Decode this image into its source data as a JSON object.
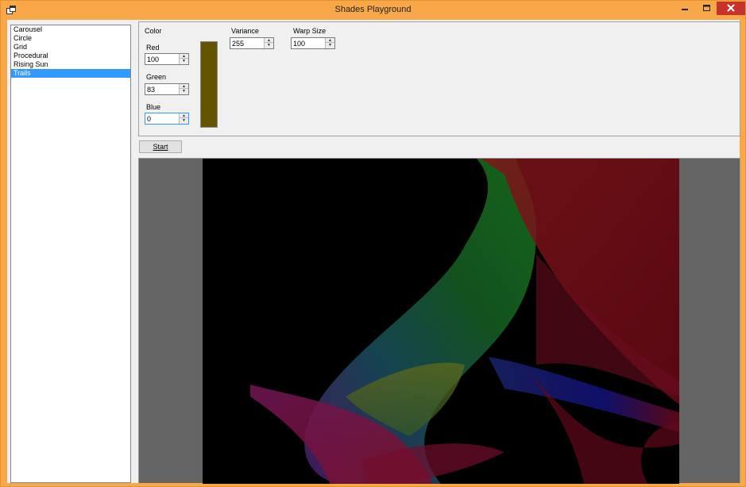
{
  "window": {
    "title": "Shades Playground"
  },
  "list": {
    "items": [
      "Carousel",
      "Circle",
      "Grid",
      "Procedural",
      "Rising Sun",
      "Trails"
    ],
    "selected_index": 5
  },
  "panel": {
    "color_label": "Color",
    "red_label": "Red",
    "red_value": "100",
    "green_label": "Green",
    "green_value": "83",
    "blue_label": "Blue",
    "blue_value": "0",
    "variance_label": "Variance",
    "variance_value": "255",
    "warp_label": "Warp Size",
    "warp_value": "100",
    "swatch_color": "#645300"
  },
  "start_button": {
    "label": "Start"
  },
  "colors": {
    "frame": "#f8a848",
    "close_button": "#c7322b",
    "selection": "#3399ff",
    "canvas_margin": "#646464",
    "canvas_bg": "#000000"
  },
  "icons": {
    "app": "app-icon",
    "minimize": "minimize-icon",
    "maximize": "maximize-icon",
    "close": "close-icon"
  }
}
